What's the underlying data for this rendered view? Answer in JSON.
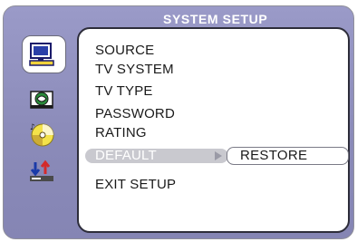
{
  "header": {
    "title": "SYSTEM SETUP"
  },
  "sidebar": {
    "icons": [
      {
        "name": "general-setup-icon",
        "selected": true
      },
      {
        "name": "audio-setup-icon",
        "selected": false
      },
      {
        "name": "dolby-disc-icon",
        "selected": false
      },
      {
        "name": "preference-setup-icon",
        "selected": false
      }
    ]
  },
  "menu": {
    "items": [
      {
        "label": "SOURCE"
      },
      {
        "label": "TV SYSTEM"
      },
      {
        "label": "TV TYPE"
      },
      {
        "label": "PASSWORD"
      },
      {
        "label": "RATING"
      },
      {
        "label": "DEFAULT",
        "selected": true
      },
      {
        "label": "EXIT SETUP"
      }
    ]
  },
  "submenu": {
    "option_label": "RESTORE"
  },
  "colors": {
    "background": "#8a8ab8",
    "panel": "#ffffff",
    "highlight": "#c9c9cf",
    "title_text": "#ffffff"
  }
}
